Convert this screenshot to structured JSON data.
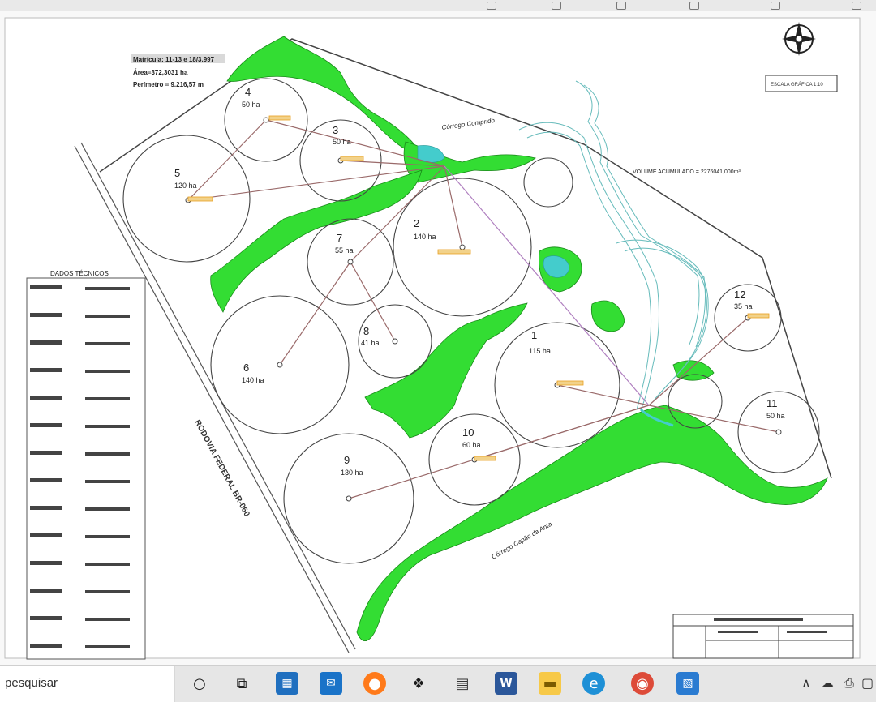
{
  "map": {
    "property_info": {
      "line1": "Matrícula: 11-13 e 18/3.997",
      "line2": "Área=372,3031 ha",
      "line3": "Perímetro = 9.216,57 m"
    },
    "volume_label": "VOLUME ACUMULADO = 2276041,000m³",
    "stream_1": "Córrego Comprido",
    "stream_2": "Córrego Capão da Anta",
    "highway_label": "RODOVIA FEDERAL BR-060",
    "technical_title": "DADOS TÉCNICOS",
    "scale_box": "ESCALA GRÁFICA 1:10",
    "pivots": [
      {
        "id": "1",
        "area": "115 ha"
      },
      {
        "id": "2",
        "area": "140 ha"
      },
      {
        "id": "3",
        "area": "50 ha"
      },
      {
        "id": "4",
        "area": "50 ha"
      },
      {
        "id": "5",
        "area": "120 ha"
      },
      {
        "id": "6",
        "area": "140 ha"
      },
      {
        "id": "7",
        "area": "55 ha"
      },
      {
        "id": "8",
        "area": "41 ha"
      },
      {
        "id": "9",
        "area": "130 ha"
      },
      {
        "id": "10",
        "area": "60 ha"
      },
      {
        "id": "11",
        "area": "50 ha"
      },
      {
        "id": "12",
        "area": "35 ha"
      }
    ],
    "colors": {
      "vegetation": "#33dd33",
      "water": "#44cccc",
      "line": "#444444",
      "pipeline": "#a07070",
      "pump_label": "#e8a020"
    }
  },
  "taskbar": {
    "search_text": "pesquisar",
    "icons": [
      "search-circle-icon",
      "task-view-icon",
      "store-icon",
      "mail-icon",
      "firefox-icon",
      "dropbox-icon",
      "calculator-icon",
      "word-icon",
      "file-explorer-icon",
      "edge-icon",
      "chrome-icon",
      "photos-icon"
    ]
  }
}
